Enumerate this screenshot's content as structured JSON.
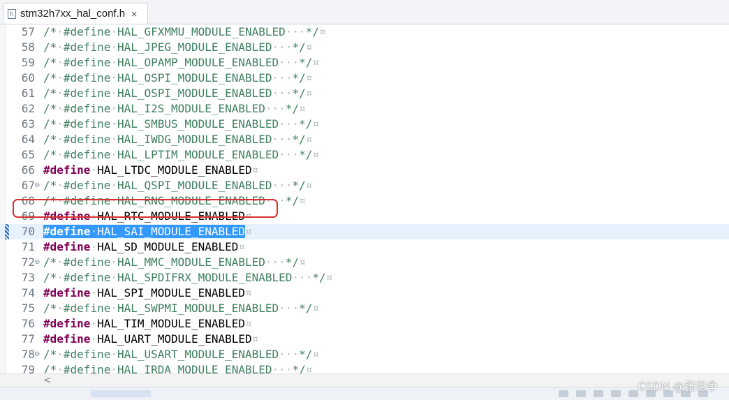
{
  "tab": {
    "label": "stm32h7xx_hal_conf.h",
    "close": "×",
    "icon_name": "header-file-icon",
    "icon_letter": "h"
  },
  "fold_glyph": "⊖",
  "whitespace_marks": {
    "space": "·",
    "eol": "¤"
  },
  "colors": {
    "comment": "#3f7f5f",
    "keyword": "#7f0055",
    "selection": "#3399ff",
    "current_line": "#e8f2fe",
    "highlight_box": "#d63030"
  },
  "lines": [
    {
      "num": "57",
      "type": "comment",
      "macro": "HAL_GFXMMU_MODULE_ENABLED",
      "fold": false
    },
    {
      "num": "58",
      "type": "comment",
      "macro": "HAL_JPEG_MODULE_ENABLED",
      "fold": false
    },
    {
      "num": "59",
      "type": "comment",
      "macro": "HAL_OPAMP_MODULE_ENABLED",
      "fold": false
    },
    {
      "num": "60",
      "type": "comment",
      "macro": "HAL_OSPI_MODULE_ENABLED",
      "fold": false
    },
    {
      "num": "61",
      "type": "comment",
      "macro": "HAL_OSPI_MODULE_ENABLED",
      "fold": false
    },
    {
      "num": "62",
      "type": "comment",
      "macro": "HAL_I2S_MODULE_ENABLED",
      "fold": false
    },
    {
      "num": "63",
      "type": "comment",
      "macro": "HAL_SMBUS_MODULE_ENABLED",
      "fold": false
    },
    {
      "num": "64",
      "type": "comment",
      "macro": "HAL_IWDG_MODULE_ENABLED",
      "fold": false
    },
    {
      "num": "65",
      "type": "comment",
      "macro": "HAL_LPTIM_MODULE_ENABLED",
      "fold": false
    },
    {
      "num": "66",
      "type": "define",
      "macro": "HAL_LTDC_MODULE_ENABLED",
      "fold": false
    },
    {
      "num": "67",
      "type": "comment",
      "macro": "HAL_QSPI_MODULE_ENABLED",
      "fold": true
    },
    {
      "num": "68",
      "type": "comment",
      "macro": "HAL_RNG_MODULE_ENABLED",
      "fold": false
    },
    {
      "num": "69",
      "type": "define",
      "macro": "HAL_RTC_MODULE_ENABLED",
      "fold": false
    },
    {
      "num": "70",
      "type": "define",
      "macro": "HAL_SAI_MODULE_ENABLED",
      "fold": false,
      "current": true,
      "selected": true
    },
    {
      "num": "71",
      "type": "define",
      "macro": "HAL_SD_MODULE_ENABLED",
      "fold": false
    },
    {
      "num": "72",
      "type": "comment",
      "macro": "HAL_MMC_MODULE_ENABLED",
      "fold": true
    },
    {
      "num": "73",
      "type": "comment",
      "macro": "HAL_SPDIFRX_MODULE_ENABLED",
      "fold": false
    },
    {
      "num": "74",
      "type": "define",
      "macro": "HAL_SPI_MODULE_ENABLED",
      "fold": false
    },
    {
      "num": "75",
      "type": "comment",
      "macro": "HAL_SWPMI_MODULE_ENABLED",
      "fold": false
    },
    {
      "num": "76",
      "type": "define",
      "macro": "HAL_TIM_MODULE_ENABLED",
      "fold": false
    },
    {
      "num": "77",
      "type": "define",
      "macro": "HAL_UART_MODULE_ENABLED",
      "fold": false
    },
    {
      "num": "78",
      "type": "comment",
      "macro": "HAL_USART_MODULE_ENABLED",
      "fold": true
    },
    {
      "num": "79",
      "type": "comment",
      "macro": "HAL_IRDA_MODULE_ENABLED",
      "fold": false
    }
  ],
  "keyword": "#define",
  "comment_open": "/*",
  "comment_close": "*/",
  "scroll_left_glyph": "<",
  "watermark": "CSDN @张世争"
}
